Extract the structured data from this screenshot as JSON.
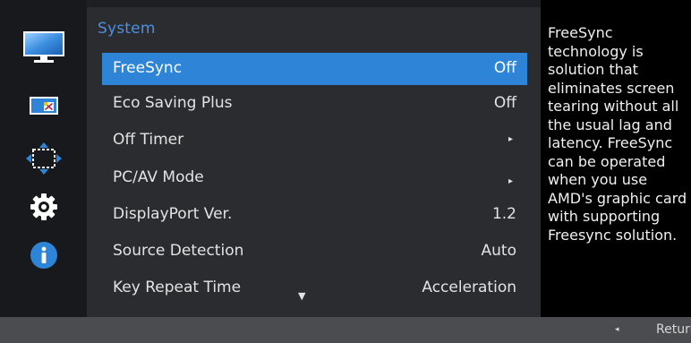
{
  "sidebar": {
    "items": [
      {
        "icon": "picture-icon"
      },
      {
        "icon": "onscreen-display-icon"
      },
      {
        "icon": "position-icon"
      },
      {
        "icon": "settings-gear-icon"
      },
      {
        "icon": "information-icon"
      }
    ]
  },
  "menu": {
    "title": "System",
    "items": [
      {
        "label": "FreeSync",
        "value": "Off"
      },
      {
        "label": "Eco Saving Plus",
        "value": "Off"
      },
      {
        "label": "Off Timer",
        "value": "▸"
      },
      {
        "label": "PC/AV Mode",
        "value": "▸"
      },
      {
        "label": "DisplayPort Ver.",
        "value": "1.2"
      },
      {
        "label": "Source Detection",
        "value": "Auto"
      },
      {
        "label": "Key Repeat Time",
        "value": "Acceleration"
      }
    ],
    "scroll_indicator": "▼"
  },
  "help": {
    "text": "FreeSync\ntechnology is\nsolution that\neliminates screen\ntearing without all\nthe usual lag and\nlatency. FreeSync\ncan be operated\nwhen you use\nAMD's graphic card\nwith supporting\nFreesync solution."
  },
  "footer": {
    "return_arrow": "◂",
    "return_label": "Return"
  },
  "colors": {
    "accent": "#2e84d6",
    "title": "#4d8fe0"
  }
}
